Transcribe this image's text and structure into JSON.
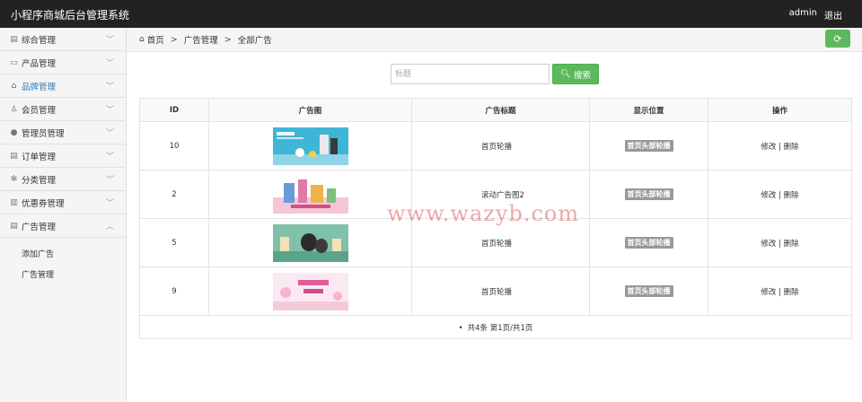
{
  "header": {
    "title": "小程序商城后台管理系统",
    "user": "admin",
    "logout": "退出"
  },
  "sidebar": {
    "items": [
      {
        "label": "综合管理",
        "icon": "list-icon",
        "glyph": "▤"
      },
      {
        "label": "产品管理",
        "icon": "image-icon",
        "glyph": "▭"
      },
      {
        "label": "品牌管理",
        "icon": "bag-icon",
        "glyph": "⌂"
      },
      {
        "label": "会员管理",
        "icon": "user-outline-icon",
        "glyph": "♙"
      },
      {
        "label": "管理员管理",
        "icon": "user-icon",
        "glyph": "●"
      },
      {
        "label": "订单管理",
        "icon": "list-alt-icon",
        "glyph": "▤"
      },
      {
        "label": "分类管理",
        "icon": "gear-icon",
        "glyph": "✻"
      },
      {
        "label": "优惠券管理",
        "icon": "book-icon",
        "glyph": "▥"
      },
      {
        "label": "广告管理",
        "icon": "list-icon",
        "glyph": "▤"
      }
    ],
    "sub_items": [
      {
        "label": "添加广告"
      },
      {
        "label": "广告管理"
      }
    ],
    "active_color": "#337ab7"
  },
  "breadcrumb": {
    "home": "首页",
    "sep": ">",
    "level2": "广告管理",
    "level3": "全部广告"
  },
  "search": {
    "placeholder": "标题",
    "button_label": "搜索"
  },
  "table": {
    "headers": {
      "id": "ID",
      "image": "广告图",
      "title": "广告标题",
      "position": "显示位置",
      "ops": "操作"
    },
    "rows": [
      {
        "id": "10",
        "title": "首页轮播",
        "position": "首页头部轮播",
        "edit": "修改",
        "sep": "|",
        "del": "删除"
      },
      {
        "id": "2",
        "title": "滚动广告图2",
        "position": "首页头部轮播",
        "edit": "修改",
        "sep": "|",
        "del": "删除"
      },
      {
        "id": "5",
        "title": "首页轮播",
        "position": "首页头部轮播",
        "edit": "修改",
        "sep": "|",
        "del": "删除"
      },
      {
        "id": "9",
        "title": "首页轮播",
        "position": "首页头部轮播",
        "edit": "修改",
        "sep": "|",
        "del": "删除"
      }
    ],
    "pager": "共4条 第1页/共1页"
  },
  "watermark": {
    "text": "www.wazyb.com"
  },
  "colors": {
    "topbar": "#222222",
    "green": "#5cb85c",
    "badge": "#999999"
  }
}
